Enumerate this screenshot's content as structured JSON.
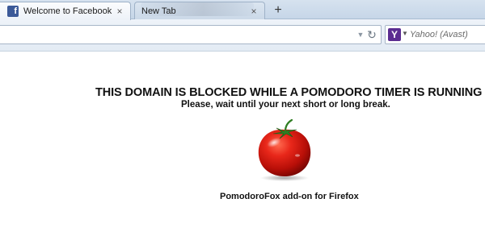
{
  "tabs": [
    {
      "title": "Welcome to Facebook - Lo...",
      "favicon": "facebook-icon",
      "active": true
    },
    {
      "title": "New Tab",
      "active": false
    }
  ],
  "new_tab_symbol": "+",
  "close_symbol": "×",
  "navbar": {
    "search_engine": {
      "icon": "yahoo-icon",
      "glyph": "Y",
      "color": "#5b2d91"
    },
    "search_placeholder": "Yahoo! (Avast)"
  },
  "page": {
    "headline": "THIS DOMAIN IS BLOCKED WHILE A POMODORO TIMER IS RUNNING",
    "subline": "Please, wait until your next short or long break.",
    "image": "tomato-image",
    "credit": "PomodoroFox add-on for Firefox"
  },
  "colors": {
    "facebook_blue": "#3b5998",
    "tomato_red": "#d81e12",
    "stem_green": "#2f7d22"
  }
}
